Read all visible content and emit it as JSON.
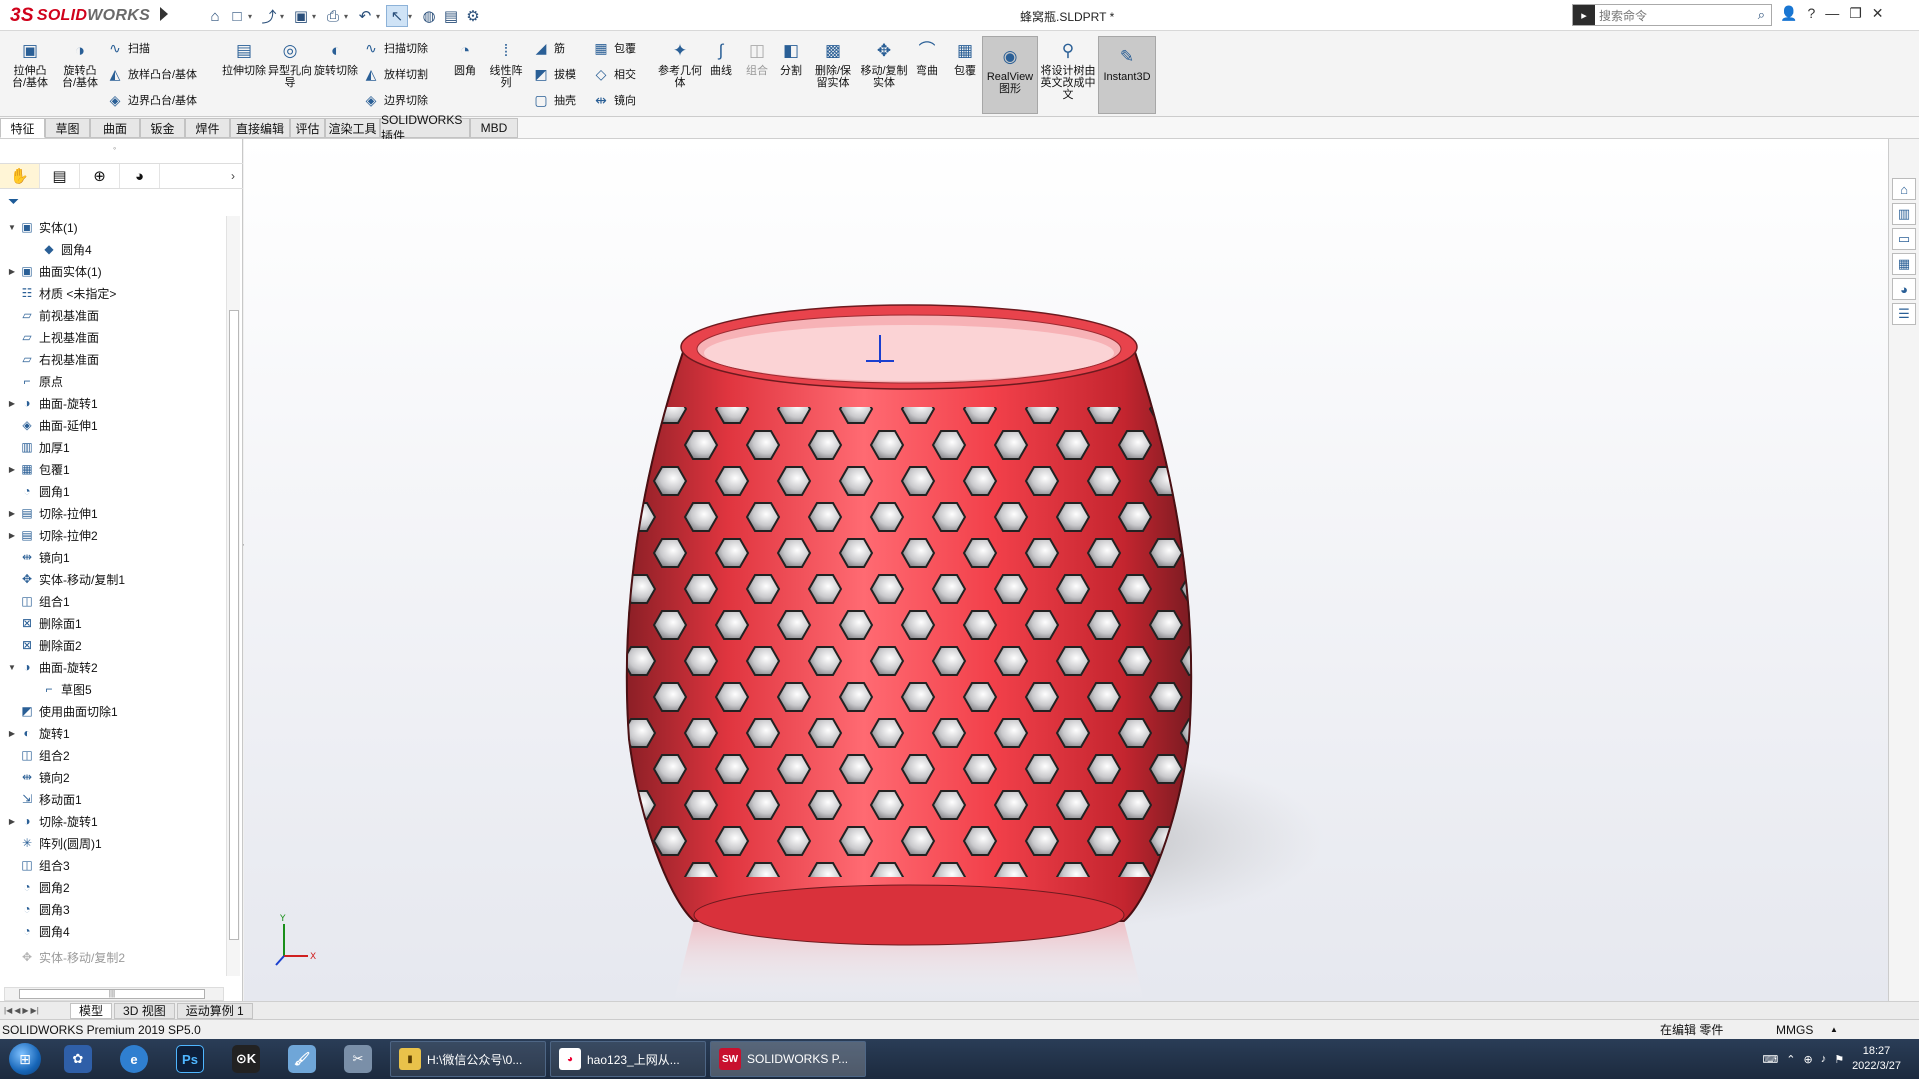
{
  "app": {
    "logo_prefix": "3S",
    "logo_brand": "SOLID",
    "logo_suffix": "WORKS",
    "doc_title": "蜂窝瓶.SLDPRT *",
    "search_placeholder": "搜索命令",
    "search_prefix_icon": "book-icon"
  },
  "window_buttons": [
    "user-icon",
    "help-icon",
    "minimize-icon",
    "restore-icon",
    "close-icon"
  ],
  "quick_access": [
    {
      "name": "home-icon",
      "glyph": "⌂"
    },
    {
      "name": "new-document-icon",
      "glyph": "□"
    },
    {
      "name": "open-icon",
      "glyph": "⤴"
    },
    {
      "name": "save-icon",
      "glyph": "▣"
    },
    {
      "name": "print-icon",
      "glyph": "⎙"
    },
    {
      "name": "undo-icon",
      "glyph": "↶"
    },
    {
      "name": "select-arrow-icon",
      "glyph": "↖"
    },
    {
      "name": "traffic-light-icon",
      "glyph": "◍"
    },
    {
      "name": "file-properties-icon",
      "glyph": "▤"
    },
    {
      "name": "options-gear-icon",
      "glyph": "⚙"
    }
  ],
  "ribbon": {
    "extrude_boss": "拉伸凸台/基体",
    "revolve_boss": "旋转凸台/基体",
    "sweep": "扫描",
    "loft_boss": "放样凸台/基体",
    "boundary_boss": "边界凸台/基体",
    "extrude_cut": "拉伸切除",
    "hole_wizard": "异型孔向导",
    "revolve_cut": "旋转切除",
    "swept_cut": "扫描切除",
    "lofted_cut": "放样切割",
    "boundary_cut": "边界切除",
    "fillet": "圆角",
    "linear_pattern": "线性阵列",
    "rib": "筋",
    "draft": "拔模",
    "shell": "抽壳",
    "wrap": "包覆",
    "intersect": "相交",
    "mirror": "镜向",
    "ref_geometry": "参考几何体",
    "curves": "曲线",
    "combine": "组合",
    "split": "分割",
    "delete_keep_body": "删除/保留实体",
    "move_copy_body": "移动/复制实体",
    "flex": "弯曲",
    "wrap2": "包覆",
    "realview": "RealView图形",
    "translate_tree": "将设计树由英文改成中文",
    "instant3d": "Instant3D"
  },
  "cmd_tabs": [
    "特征",
    "草图",
    "曲面",
    "钣金",
    "焊件",
    "直接编辑",
    "评估",
    "渲染工具",
    "SOLIDWORKS 插件",
    "MBD"
  ],
  "cmd_tab_active": "特征",
  "feature_tree": [
    {
      "label": "实体(1)",
      "icon": "solid-bodies-folder-icon",
      "expander": "▼",
      "indent": 0
    },
    {
      "label": "圆角4",
      "icon": "solid-body-icon",
      "expander": "",
      "indent": 1
    },
    {
      "label": "曲面实体(1)",
      "icon": "surface-bodies-folder-icon",
      "expander": "▶",
      "indent": 0
    },
    {
      "label": "材质 <未指定>",
      "icon": "material-icon",
      "expander": "",
      "indent": 0
    },
    {
      "label": "前视基准面",
      "icon": "plane-icon",
      "expander": "",
      "indent": 0
    },
    {
      "label": "上视基准面",
      "icon": "plane-icon",
      "expander": "",
      "indent": 0
    },
    {
      "label": "右视基准面",
      "icon": "plane-icon",
      "expander": "",
      "indent": 0
    },
    {
      "label": "原点",
      "icon": "origin-icon",
      "expander": "",
      "indent": 0
    },
    {
      "label": "曲面-旋转1",
      "icon": "surface-revolve-icon",
      "expander": "▶",
      "indent": 0
    },
    {
      "label": "曲面-延伸1",
      "icon": "surface-extend-icon",
      "expander": "",
      "indent": 0
    },
    {
      "label": "加厚1",
      "icon": "thicken-icon",
      "expander": "",
      "indent": 0
    },
    {
      "label": "包覆1",
      "icon": "wrap-icon",
      "expander": "▶",
      "indent": 0
    },
    {
      "label": "圆角1",
      "icon": "fillet-icon",
      "expander": "",
      "indent": 0
    },
    {
      "label": "切除-拉伸1",
      "icon": "cut-extrude-icon",
      "expander": "▶",
      "indent": 0
    },
    {
      "label": "切除-拉伸2",
      "icon": "cut-extrude-icon",
      "expander": "▶",
      "indent": 0
    },
    {
      "label": "镜向1",
      "icon": "mirror-icon",
      "expander": "",
      "indent": 0
    },
    {
      "label": "实体-移动/复制1",
      "icon": "move-copy-icon",
      "expander": "",
      "indent": 0
    },
    {
      "label": "组合1",
      "icon": "combine-icon",
      "expander": "",
      "indent": 0
    },
    {
      "label": "删除面1",
      "icon": "delete-face-icon",
      "expander": "",
      "indent": 0
    },
    {
      "label": "删除面2",
      "icon": "delete-face-icon",
      "expander": "",
      "indent": 0
    },
    {
      "label": "曲面-旋转2",
      "icon": "surface-revolve-icon",
      "expander": "▼",
      "indent": 0
    },
    {
      "label": "草图5",
      "icon": "sketch-icon",
      "expander": "",
      "indent": 1
    },
    {
      "label": "使用曲面切除1",
      "icon": "surface-cut-icon",
      "expander": "",
      "indent": 0
    },
    {
      "label": "旋转1",
      "icon": "revolve-icon",
      "expander": "▶",
      "indent": 0
    },
    {
      "label": "组合2",
      "icon": "combine-icon",
      "expander": "",
      "indent": 0
    },
    {
      "label": "镜向2",
      "icon": "mirror-icon",
      "expander": "",
      "indent": 0
    },
    {
      "label": "移动面1",
      "icon": "move-face-icon",
      "expander": "",
      "indent": 0
    },
    {
      "label": "切除-旋转1",
      "icon": "cut-revolve-icon",
      "expander": "▶",
      "indent": 0
    },
    {
      "label": "阵列(圆周)1",
      "icon": "circular-pattern-icon",
      "expander": "",
      "indent": 0
    },
    {
      "label": "组合3",
      "icon": "combine-icon",
      "expander": "",
      "indent": 0
    },
    {
      "label": "圆角2",
      "icon": "fillet-icon",
      "expander": "",
      "indent": 0
    },
    {
      "label": "圆角3",
      "icon": "fillet-icon",
      "expander": "",
      "indent": 0
    },
    {
      "label": "圆角4",
      "icon": "fillet-icon",
      "expander": "",
      "indent": 0
    },
    {
      "label": "实体-移动/复制2",
      "icon": "move-copy-icon",
      "expander": "",
      "indent": 0,
      "suppressed": true
    }
  ],
  "bottom_tabs": [
    "模型",
    "3D 视图",
    "运动算例 1"
  ],
  "bottom_tab_active": "模型",
  "status": {
    "left": "SOLIDWORKS Premium 2019 SP5.0",
    "editing": "在编辑 零件",
    "units": "MMGS"
  },
  "taskbar": {
    "windows": [
      {
        "label": "H:\\微信公众号\\0...",
        "icon": "folder-icon"
      },
      {
        "label": "hao123_上网从...",
        "icon": "browser-icon"
      },
      {
        "label": "SOLIDWORKS P...",
        "icon": "solidworks-icon",
        "active": true
      }
    ],
    "apps": [
      "ie-icon",
      "photoshop-icon",
      "video-icon",
      "paint-icon",
      "tool-icon"
    ],
    "time": "18:27",
    "date": "2022/3/27"
  },
  "colors": {
    "brand_red": "#d0021b",
    "part_red": "#ee3b45",
    "tree_accent": "#2a5f96",
    "taskbar": "#1f2e44"
  }
}
